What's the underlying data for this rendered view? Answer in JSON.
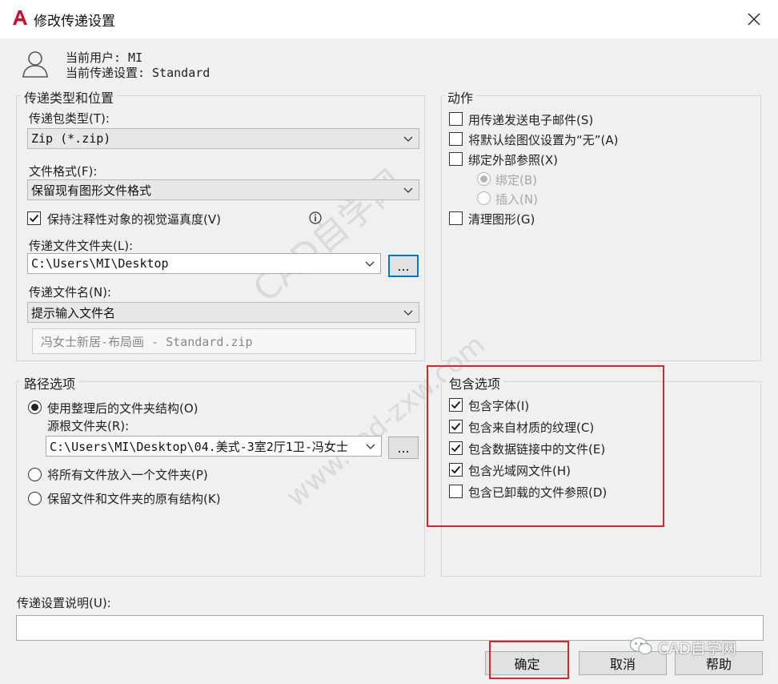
{
  "window": {
    "title": "修改传递设置"
  },
  "user": {
    "current_user": "当前用户: MI",
    "current_setting": "当前传递设置: Standard"
  },
  "transmittal": {
    "group_label": "传递类型和位置",
    "package_type_label": "传递包类型(T):",
    "package_type_value": "Zip (*.zip)",
    "file_format_label": "文件格式(F):",
    "file_format_value": "保留现有图形文件格式",
    "keep_annotative_label": "保持注释性对象的视觉逼真度(V)",
    "keep_annotative_checked": true,
    "folder_label": "传递文件文件夹(L):",
    "folder_value": "C:\\Users\\MI\\Desktop",
    "browse_label": "...",
    "filename_label": "传递文件名(N):",
    "filename_value": "提示输入文件名",
    "filename_preview": "冯女士新居-布局画 - Standard.zip"
  },
  "actions": {
    "group_label": "动作",
    "items": [
      {
        "label": "用传递发送电子邮件(S)",
        "checked": false
      },
      {
        "label": "将默认绘图仪设置为“无”(A)",
        "checked": false
      },
      {
        "label": "绑定外部参照(X)",
        "checked": false
      }
    ],
    "radio_bind": "绑定(B)",
    "radio_insert": "插入(N)",
    "purge_label": "清理图形(G)"
  },
  "path": {
    "group_label": "路径选项",
    "option_organized": "使用整理后的文件夹结构(O)",
    "source_root_label": "源根文件夹(R):",
    "source_root_value": "C:\\Users\\MI\\Desktop\\04.美式-3室2厅1卫-冯女士",
    "browse_label": "...",
    "option_single": "将所有文件放入一个文件夹(P)",
    "option_keep": "保留文件和文件夹的原有结构(K)"
  },
  "include": {
    "group_label": "包含选项",
    "items": [
      {
        "label": "包含字体(I)",
        "checked": true
      },
      {
        "label": "包含来自材质的纹理(C)",
        "checked": true
      },
      {
        "label": "包含数据链接中的文件(E)",
        "checked": true
      },
      {
        "label": "包含光域网文件(H)",
        "checked": true
      },
      {
        "label": "包含已卸载的文件参照(D)",
        "checked": false
      }
    ]
  },
  "description": {
    "label": "传递设置说明(U):",
    "value": ""
  },
  "buttons": {
    "ok": "确定",
    "cancel": "取消",
    "help": "帮助"
  },
  "watermark": {
    "text1": "CAD自学网",
    "text2": "www.cad-zxw.com",
    "wechat": "CAD自学网"
  },
  "colors": {
    "highlight_red": "#d9262c",
    "autocad_red": "#c8102e",
    "focus_blue": "#0078d7"
  }
}
